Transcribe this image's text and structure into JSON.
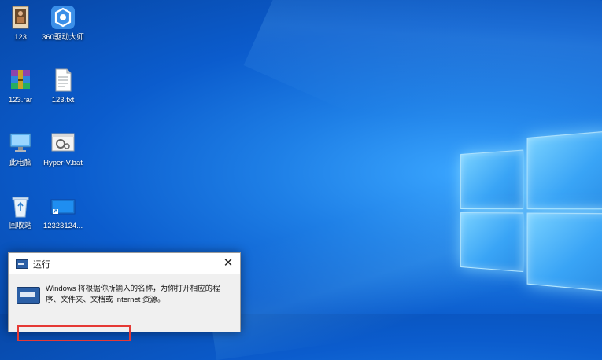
{
  "desktop": {
    "icons": [
      {
        "label": "123",
        "icon": "image-file-icon"
      },
      {
        "label": "360驱动大师",
        "icon": "driver-master-icon"
      },
      {
        "label": "123.rar",
        "icon": "rar-archive-icon"
      },
      {
        "label": "123.txt",
        "icon": "text-file-icon"
      },
      {
        "label": "此电脑",
        "icon": "this-pc-icon"
      },
      {
        "label": "Hyper-V.bat",
        "icon": "batch-file-icon"
      },
      {
        "label": "回收站",
        "icon": "recycle-bin-icon"
      },
      {
        "label": "12323124...",
        "icon": "shortcut-icon"
      }
    ]
  },
  "run_dialog": {
    "title": "运行",
    "close_glyph": "✕",
    "description": "Windows 将根据你所输入的名称，为你打开相应的程序、文件夹、文档或 Internet 资源。",
    "highlight_color": "#e53935"
  }
}
